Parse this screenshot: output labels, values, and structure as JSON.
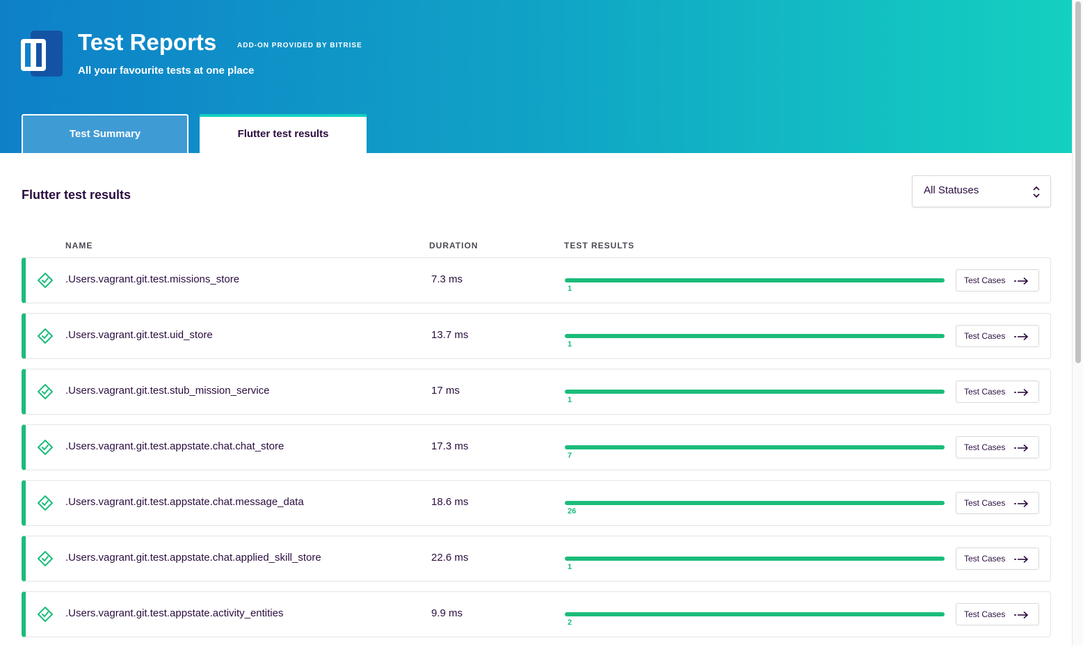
{
  "header": {
    "title": "Test Reports",
    "addon": "ADD-ON PROVIDED BY BITRISE",
    "subtitle": "All your favourite tests at one place",
    "logo_icon": "bitrise-test-reports-logo"
  },
  "tabs": [
    {
      "label": "Test Summary",
      "active": false
    },
    {
      "label": "Flutter test results",
      "active": true
    }
  ],
  "main": {
    "section_title": "Flutter test results",
    "status_filter": {
      "selected": "All Statuses"
    },
    "columns": {
      "name": "NAME",
      "duration": "DURATION",
      "results": "TEST RESULTS"
    },
    "rows": [
      {
        "name": ".Users.vagrant.git.test.missions_store",
        "duration": "7.3 ms",
        "passed": "1",
        "pass_fraction": 1.0,
        "button": "Test Cases"
      },
      {
        "name": ".Users.vagrant.git.test.uid_store",
        "duration": "13.7 ms",
        "passed": "1",
        "pass_fraction": 1.0,
        "button": "Test Cases"
      },
      {
        "name": ".Users.vagrant.git.test.stub_mission_service",
        "duration": "17 ms",
        "passed": "1",
        "pass_fraction": 1.0,
        "button": "Test Cases"
      },
      {
        "name": ".Users.vagrant.git.test.appstate.chat.chat_store",
        "duration": "17.3 ms",
        "passed": "7",
        "pass_fraction": 1.0,
        "button": "Test Cases"
      },
      {
        "name": ".Users.vagrant.git.test.appstate.chat.message_data",
        "duration": "18.6 ms",
        "passed": "26",
        "pass_fraction": 1.0,
        "button": "Test Cases"
      },
      {
        "name": ".Users.vagrant.git.test.appstate.chat.applied_skill_store",
        "duration": "22.6 ms",
        "passed": "1",
        "pass_fraction": 1.0,
        "button": "Test Cases"
      },
      {
        "name": ".Users.vagrant.git.test.appstate.activity_entities",
        "duration": "9.9 ms",
        "passed": "2",
        "pass_fraction": 1.0,
        "button": "Test Cases"
      }
    ]
  },
  "colors": {
    "success": "#1bbc7a",
    "text": "#2b0d3f",
    "header_start": "#0e80c9",
    "header_end": "#14d0c0"
  }
}
